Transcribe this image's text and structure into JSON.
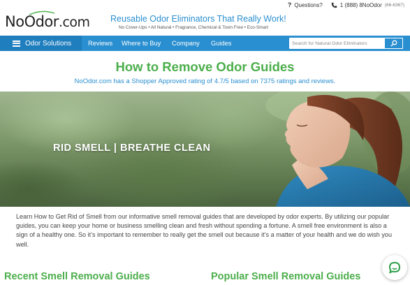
{
  "header": {
    "logo": {
      "part1": "No",
      "part2": "Odor",
      "part3": ".com"
    },
    "tagline": "Reusable Odor Eliminators That Really Work!",
    "subtagline": "No Cover-Ups • All Natural • Fragrance, Chemical & Toxin Free • Eco-Smart",
    "questions_label": "Questions?",
    "phone_label": "1 (888) 8NoOdor",
    "phone_digits": "(66-6367)"
  },
  "nav": {
    "solutions_label": "Odor Solutions",
    "items": [
      "Reviews",
      "Where to Buy",
      "Company",
      "Guides"
    ],
    "search_placeholder": "Search for Natural Odor Eliminators"
  },
  "page": {
    "title": "How to Remove Odor Guides",
    "rating_text": "NoOdor.com has a Shopper Approved rating of 4.7/5 based on 7375 ratings and reviews."
  },
  "hero": {
    "text": "RID SMELL | BREATHE CLEAN"
  },
  "intro": "Learn How to Get Rid of Smell from our informative smell removal guides that are developed by odor experts. By utilizing our popular guides, you can keep your home or business smelling clean and fresh without spending a fortune. A smell free environment is also a sign of a healthy one. So it’s important to remember to really get the smell out because it’s a matter of your health and we do wish you well.",
  "sections": {
    "recent": "Recent Smell Removal Guides",
    "popular": "Popular Smell Removal Guides"
  },
  "colors": {
    "brand_blue": "#2a8fd0",
    "brand_green": "#4cae4c",
    "nav_dark": "#1f7ebe"
  },
  "icons": {
    "menu": "hamburger-icon",
    "question": "question-icon",
    "phone": "phone-icon",
    "search": "search-icon",
    "chat": "chat-icon"
  }
}
